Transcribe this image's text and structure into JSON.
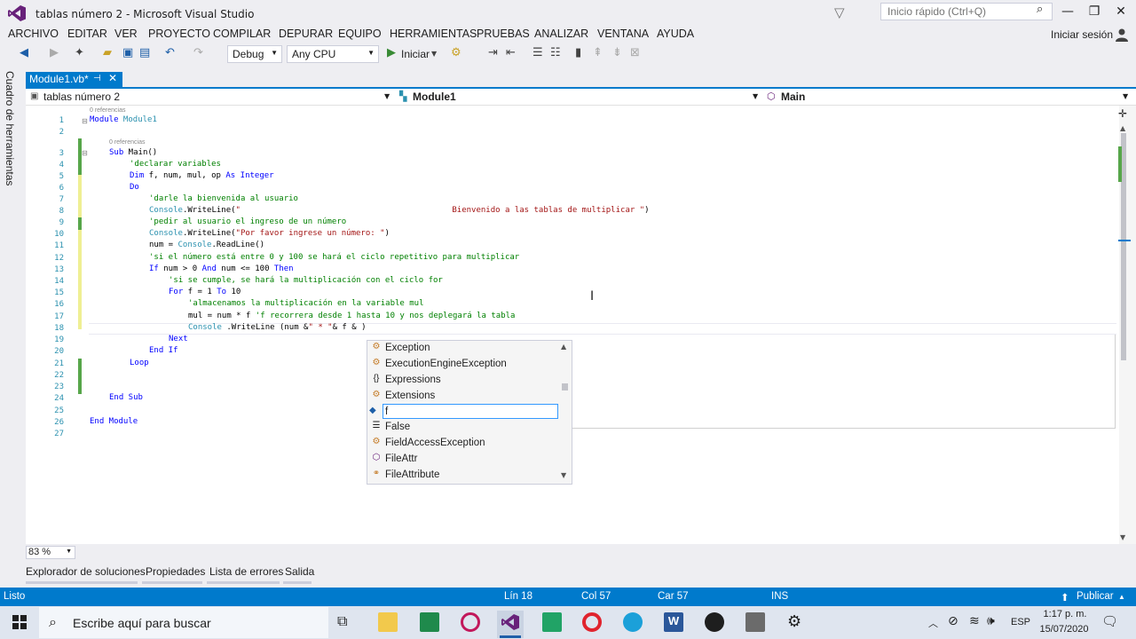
{
  "title": "tablas número 2 - Microsoft Visual Studio",
  "quick_launch": {
    "placeholder": "Inicio rápido (Ctrl+Q)"
  },
  "menu": [
    "ARCHIVO",
    "EDITAR",
    "VER",
    "PROYECTO",
    "COMPILAR",
    "DEPURAR",
    "EQUIPO",
    "HERRAMIENTAS",
    "PRUEBAS",
    "ANALIZAR",
    "VENTANA",
    "AYUDA"
  ],
  "signin": "Iniciar sesión",
  "toolbar": {
    "config": "Debug",
    "platform": "Any CPU",
    "start": "Iniciar"
  },
  "side_panel": "Cuadro de herramientas",
  "doc_tab": "Module1.vb*",
  "nav": {
    "project": "tablas número 2",
    "module": "Module1",
    "member": "Main"
  },
  "refs": {
    "module": "0 referencias",
    "sub": "0 referencias"
  },
  "code": {
    "l1_kw": "Module",
    "l1_name": " Module1",
    "l3_kw": "Sub",
    "l3_rest": " Main()",
    "l4": "'declarar variables",
    "l5_kw1": "Dim",
    "l5_mid": " f, num, mul, op ",
    "l5_kw2": "As",
    "l5_kw3": " Integer",
    "l6": "Do",
    "l7": "'darle la bienvenida al usuario",
    "l8_a": "Console",
    "l8_b": ".WriteLine(",
    "l8_str": "\"                                            Bienvenido a las tablas de multiplicar \"",
    "l8_c": ")",
    "l9": "'pedir al usuario el ingreso de un número",
    "l10_a": "Console",
    "l10_b": ".WriteLine(",
    "l10_str": "\"Por favor ingrese un número: \"",
    "l10_c": ")",
    "l11_a": "num = ",
    "l11_b": "Console",
    "l11_c": ".ReadLine()",
    "l12": "'si el número está entre 0 y 100 se hará el ciclo repetitivo para multiplicar",
    "l13_kw": "If",
    "l13_a": " num > 0 ",
    "l13_and": "And",
    "l13_b": " num <= 100 ",
    "l13_then": "Then",
    "l14": "'si se cumple, se hará la multiplicación con el ciclo for",
    "l15_for": "For",
    "l15_a": " f = 1 ",
    "l15_to": "To",
    "l15_b": " 10",
    "l16": "'almacenamos la multiplicación en la variable mul",
    "l17_a": "mul = num * f ",
    "l17_cm": "'f recorrera desde 1 hasta 10 y nos deplegará la tabla",
    "l18_a": "Console",
    "l18_b": " .WriteLine (num &",
    "l18_s1": "\" * \"",
    "l18_c": "& f & )",
    "l19": "Next",
    "l20": "End If",
    "l21": "Loop",
    "l24": "End Sub",
    "l26": "End Module"
  },
  "intellisense": [
    {
      "label": "Exception",
      "icon": "class-icon"
    },
    {
      "label": "ExecutionEngineException",
      "icon": "class-icon"
    },
    {
      "label": "Expressions",
      "icon": "namespace-icon"
    },
    {
      "label": "Extensions",
      "icon": "class-icon"
    },
    {
      "label": "f",
      "icon": "local-variable-icon"
    },
    {
      "label": "False",
      "icon": "keyword-icon"
    },
    {
      "label": "FieldAccessException",
      "icon": "class-icon"
    },
    {
      "label": "FileAttr",
      "icon": "method-icon"
    },
    {
      "label": "FileAttribute",
      "icon": "enum-icon"
    }
  ],
  "zoom": "83 %",
  "bottom_tabs": [
    "Explorador de soluciones",
    "Propiedades",
    "Lista de errores",
    "Salida"
  ],
  "status": {
    "ready": "Listo",
    "line": "Lín 18",
    "col": "Col 57",
    "car": "Car 57",
    "ins": "INS",
    "publish": "Publicar"
  },
  "taskbar": {
    "search": "Escribe aquí para buscar",
    "lang": "ESP",
    "time": "1:17 p. m.",
    "date": "15/07/2020"
  },
  "colors": {
    "accent": "#007acc",
    "vs_purple": "#68217a",
    "keyword": "#0000ff",
    "comment": "#008000",
    "string": "#a31515",
    "type": "#2b91af"
  }
}
